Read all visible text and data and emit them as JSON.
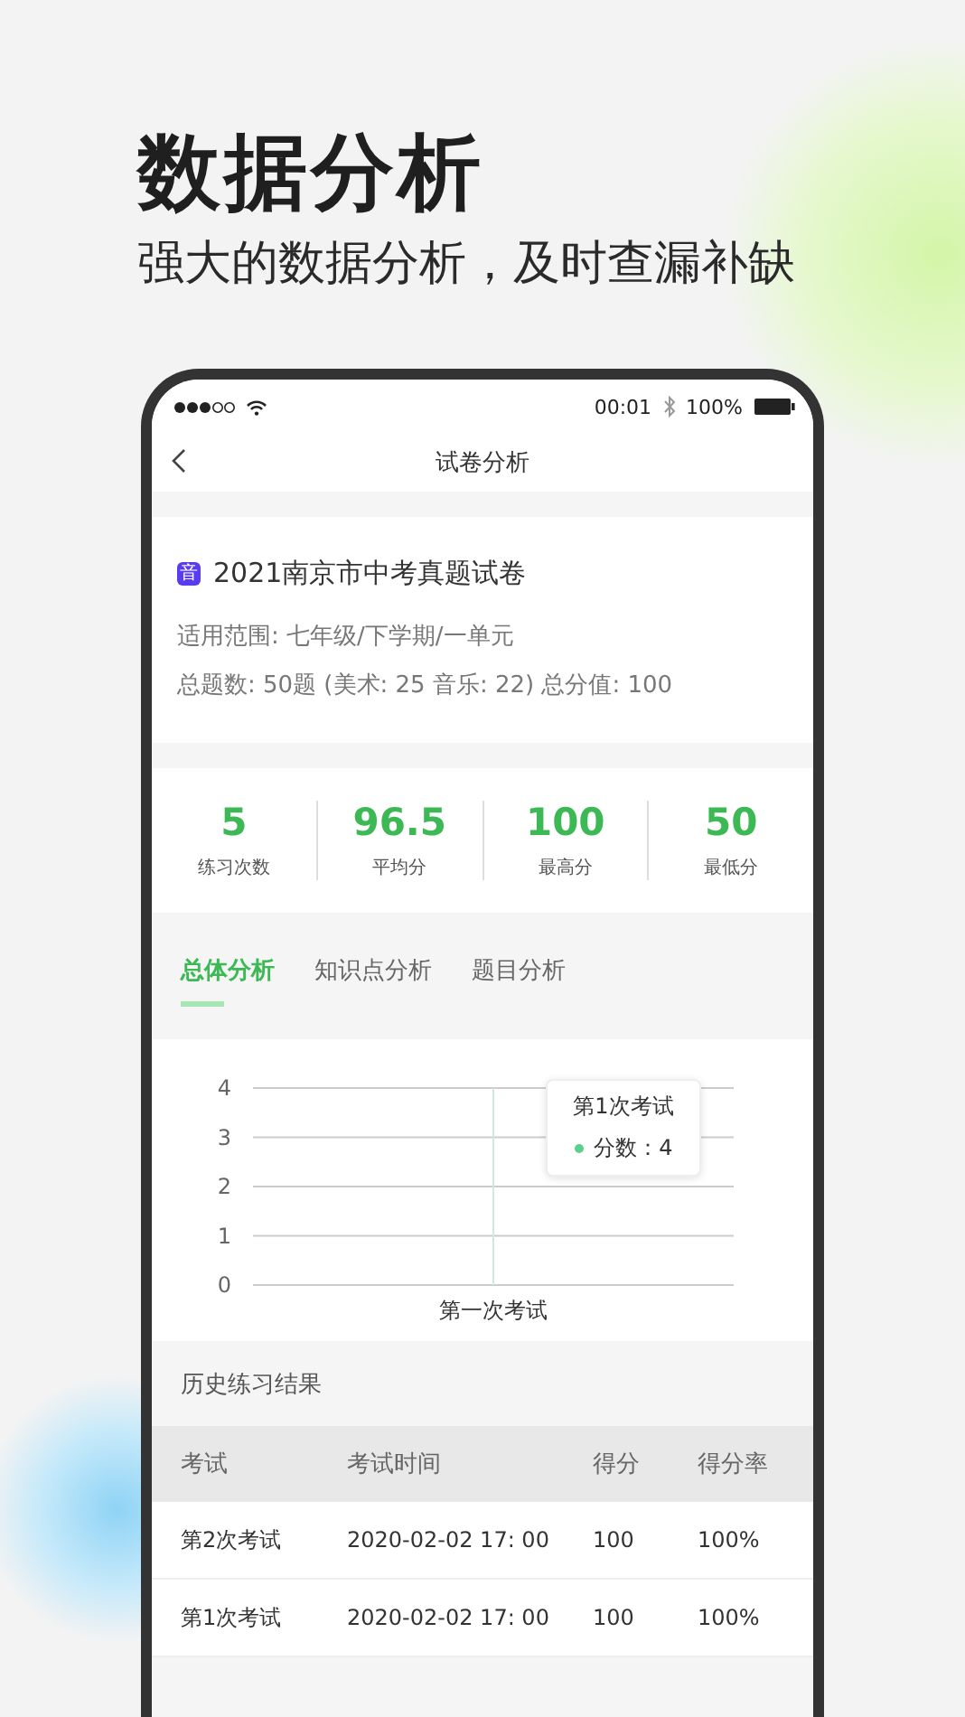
{
  "headline": {
    "title": "数据分析",
    "subtitle": "强大的数据分析，及时查漏补缺"
  },
  "status_bar": {
    "time": "00:01",
    "battery": "100%"
  },
  "nav": {
    "title": "试卷分析"
  },
  "paper": {
    "badge": "音",
    "title": "2021南京市中考真题试卷",
    "scope": "适用范围: 七年级/下学期/一单元",
    "summary": "总题数: 50题 (美术: 25  音乐: 22)   总分值: 100"
  },
  "stats": [
    {
      "value": "5",
      "label": "练习次数"
    },
    {
      "value": "96.5",
      "label": "平均分"
    },
    {
      "value": "100",
      "label": "最高分"
    },
    {
      "value": "50",
      "label": "最低分"
    }
  ],
  "tabs": [
    {
      "label": "总体分析",
      "selected": true
    },
    {
      "label": "知识点分析",
      "selected": false
    },
    {
      "label": "题目分析",
      "selected": false
    }
  ],
  "chart": {
    "y_axis_labels": [
      "4",
      "3",
      "2",
      "1",
      "0"
    ],
    "x_axis_labels": [
      "第一次考试"
    ],
    "tooltip": {
      "title": "第1次考试",
      "text": "分数：4",
      "color": "#5ad08a"
    }
  },
  "history": {
    "title": "历史练习结果",
    "columns": [
      "考试",
      "考试时间",
      "得分",
      "得分率"
    ],
    "rows": [
      [
        "第2次考试",
        "2020-02-02 17: 00",
        "100",
        "100%"
      ],
      [
        "第1次考试",
        "2020-02-02 17: 00",
        "100",
        "100%"
      ]
    ]
  }
}
